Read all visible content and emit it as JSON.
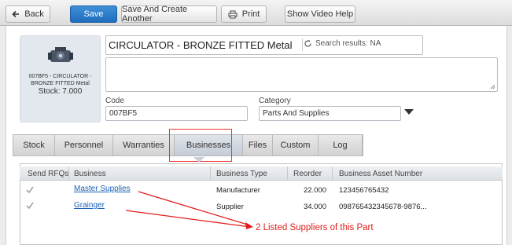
{
  "toolbar": {
    "back_label": "Back",
    "save_label": "Save",
    "save_create_label": "Save And Create Another",
    "print_label": "Print",
    "video_label": "Show Video Help"
  },
  "part": {
    "thumb_caption": "007BF5 - CIRCULATOR - BRONZE FITTED Metal",
    "stock_label": "Stock: 7.000",
    "name": "CIRCULATOR - BRONZE FITTED Metal",
    "search_results": "Search results: NA",
    "code_label": "Code",
    "code_value": "007BF5",
    "category_label": "Category",
    "category_value": "Parts And Supplies"
  },
  "tabs": [
    "Stock",
    "Personnel",
    "Warranties",
    "Businesses",
    "Files",
    "Custom",
    "Log"
  ],
  "active_tab": "Businesses",
  "grid": {
    "headers": [
      "Send RFQs",
      "Business",
      "Business Type",
      "Reorder",
      "Business Asset Number"
    ],
    "rows": [
      {
        "send_rfq": true,
        "business": "Master Supplies",
        "type": "Manufacturer",
        "reorder": "22.000",
        "asset_number": "123456765432"
      },
      {
        "send_rfq": true,
        "business": "Grainger",
        "type": "Supplier",
        "reorder": "34.000",
        "asset_number": "098765432345678-9876..."
      }
    ]
  },
  "annotation_text": "2 Listed Suppliers of this Part",
  "colors": {
    "primary_button": "#2a7bcb",
    "annotation": "#e31b1b",
    "link": "#1a5fb4"
  }
}
